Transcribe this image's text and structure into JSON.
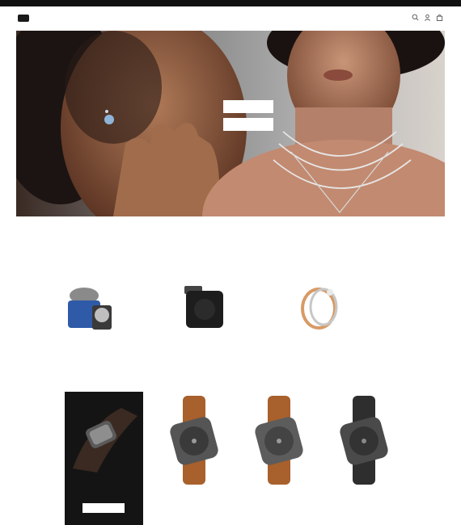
{
  "promo_bar": {
    "text": ""
  },
  "header": {
    "logo": "",
    "nav": [
      "",
      "",
      "",
      "",
      ""
    ],
    "utility_icons": [
      "search-icon",
      "account-icon",
      "bag-icon"
    ]
  },
  "hero": {
    "title": "",
    "buttons": [
      "",
      ""
    ]
  },
  "intro": {
    "eyebrow": "",
    "title": "",
    "subtitle": ""
  },
  "categories": [
    {
      "name": "",
      "link": ""
    },
    {
      "name": "",
      "link": ""
    },
    {
      "name": "",
      "link": ""
    }
  ],
  "section": {
    "title": "",
    "view_all": ""
  },
  "promo_card": {
    "lines": [
      "",
      ""
    ],
    "button": ""
  },
  "products": [
    {
      "name": "",
      "price": ""
    },
    {
      "name": "",
      "price": ""
    },
    {
      "name": "",
      "price": ""
    }
  ],
  "colors": {
    "promo_bar": "#111111",
    "hero_bg": "#8a8a8a",
    "promo_card": "#141414",
    "strap_brown": "#a8602c"
  }
}
